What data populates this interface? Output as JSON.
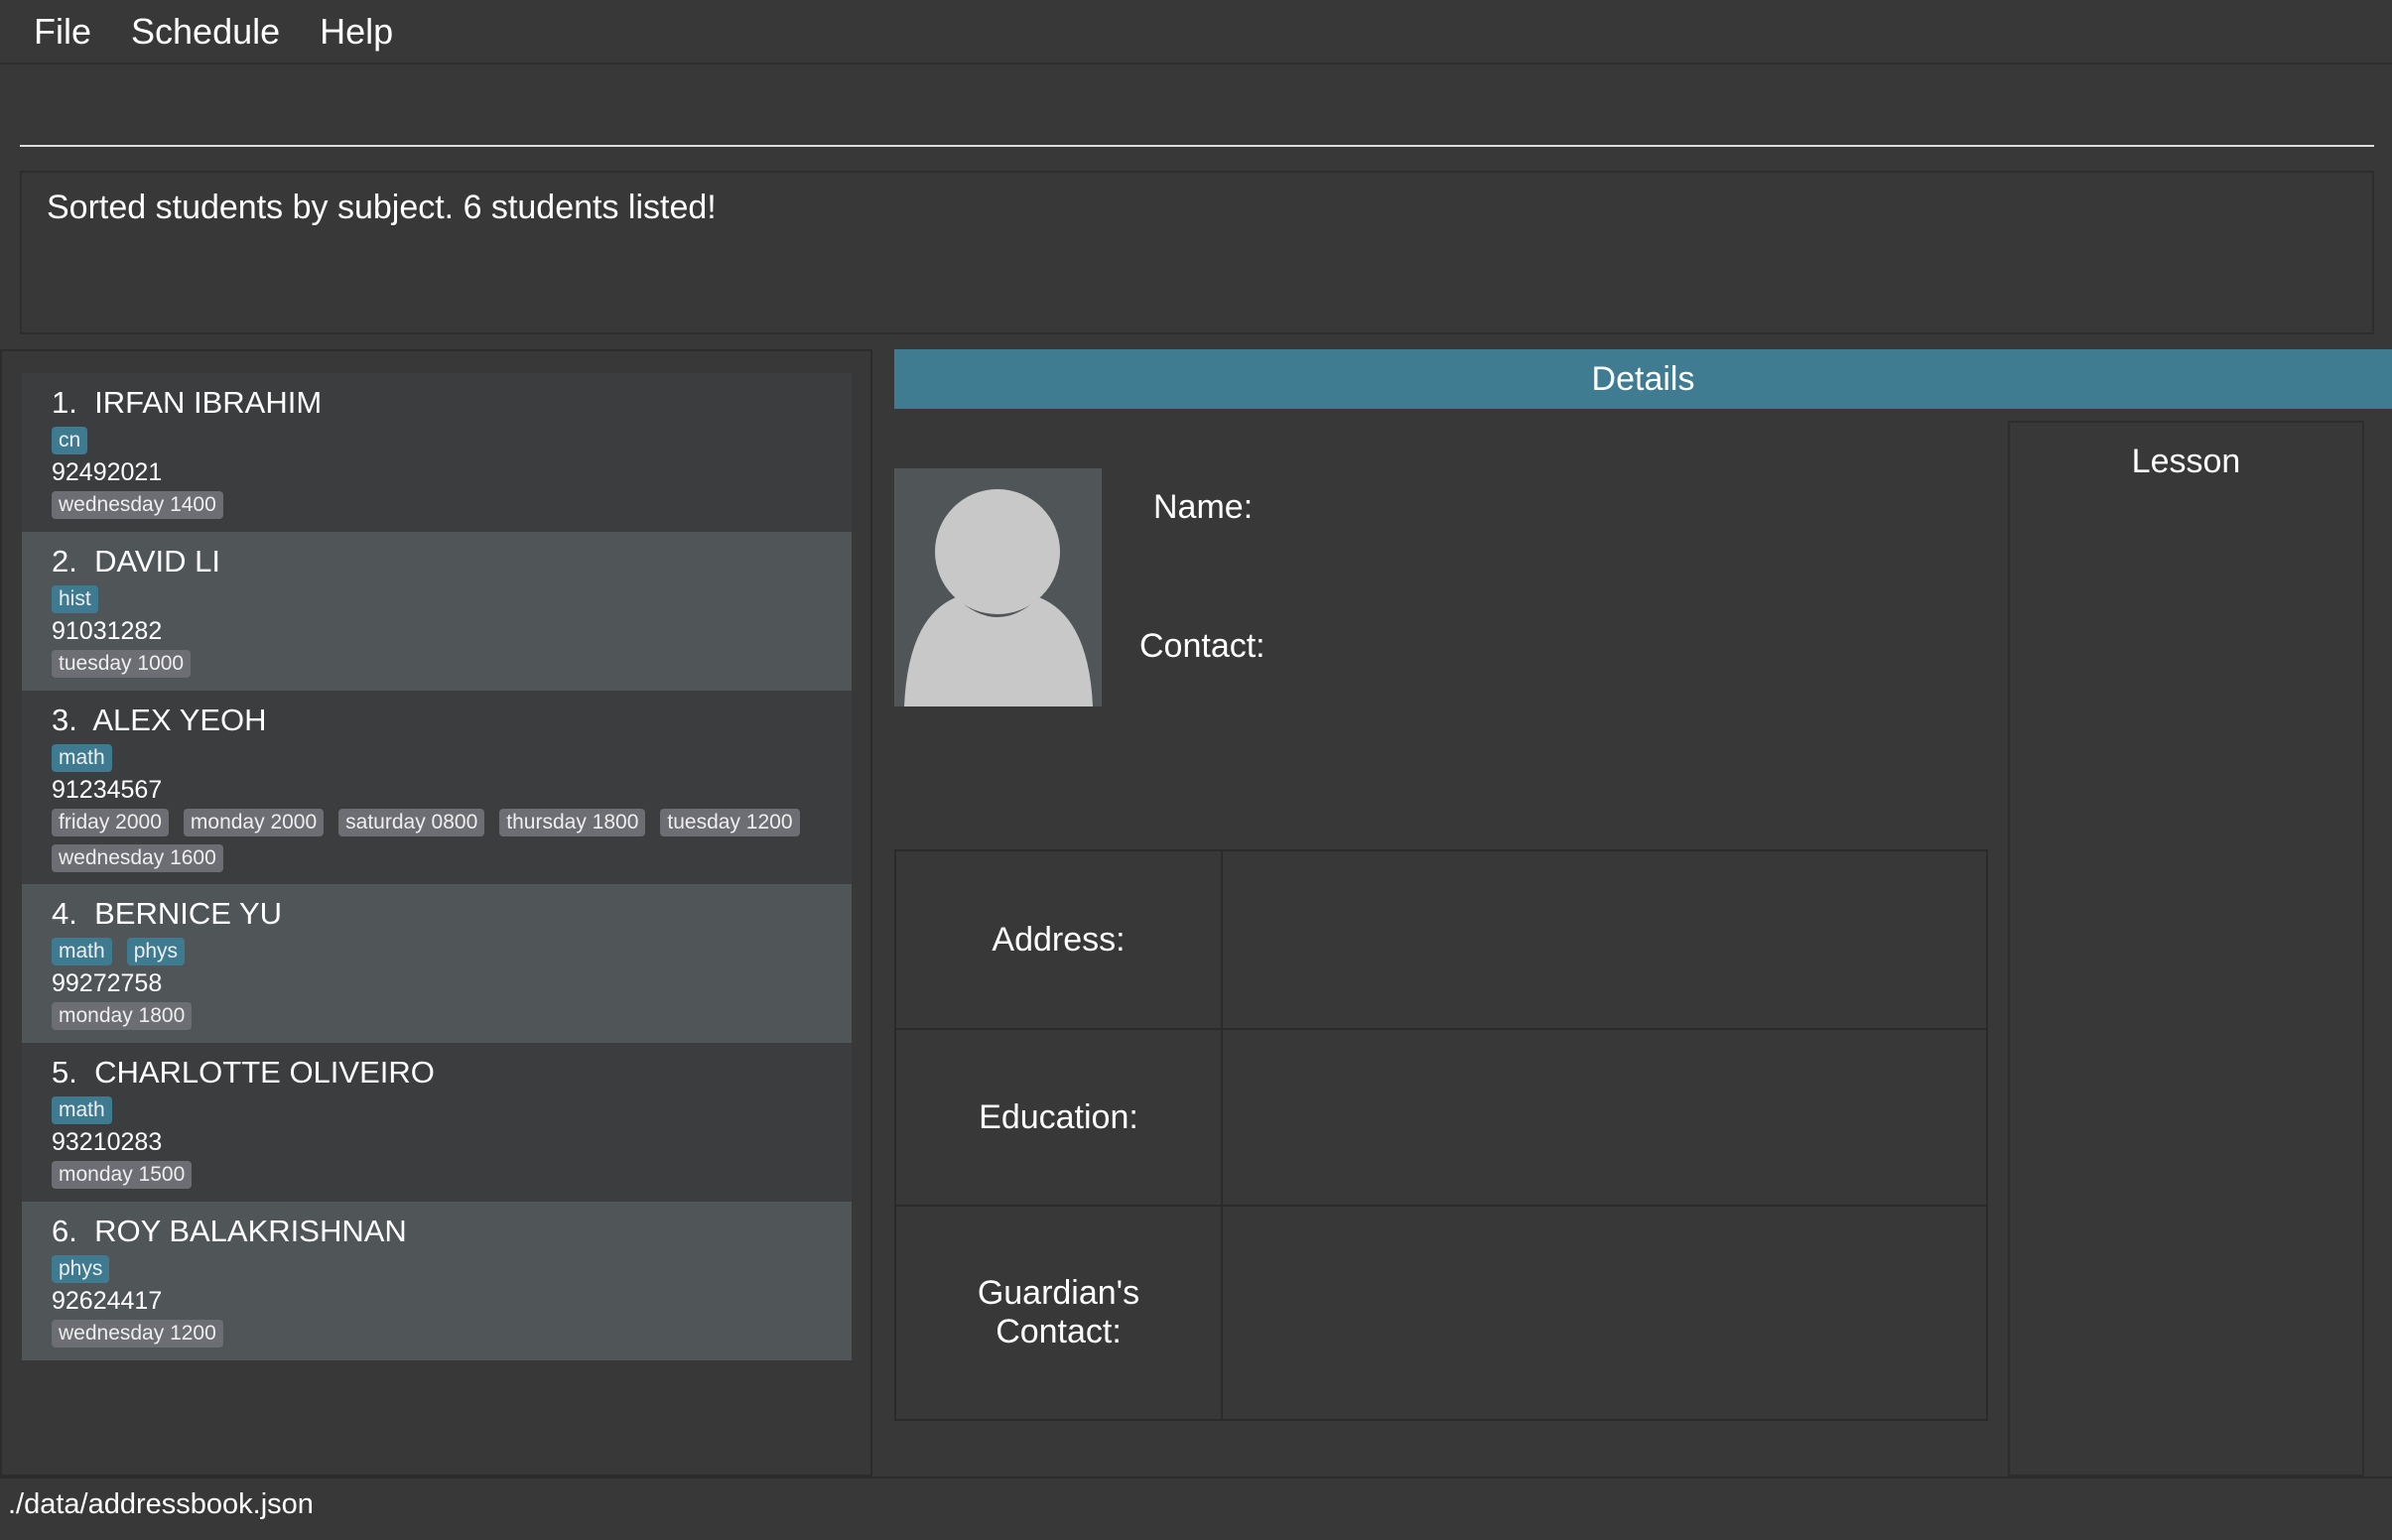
{
  "menu": [
    "File",
    "Schedule",
    "Help"
  ],
  "command": {
    "value": ""
  },
  "result": "Sorted students by subject. 6 students listed!",
  "students": [
    {
      "index": "1.",
      "name": "IRFAN IBRAHIM",
      "subjects": [
        "cn"
      ],
      "phone": "92492021",
      "lessons": [
        "wednesday 1400"
      ]
    },
    {
      "index": "2.",
      "name": "DAVID LI",
      "subjects": [
        "hist"
      ],
      "phone": "91031282",
      "lessons": [
        "tuesday 1000"
      ]
    },
    {
      "index": "3.",
      "name": "ALEX YEOH",
      "subjects": [
        "math"
      ],
      "phone": "91234567",
      "lessons": [
        "friday 2000",
        "monday 2000",
        "saturday 0800",
        "thursday 1800",
        "tuesday 1200",
        "wednesday 1600"
      ]
    },
    {
      "index": "4.",
      "name": "BERNICE YU",
      "subjects": [
        "math",
        "phys"
      ],
      "phone": "99272758",
      "lessons": [
        "monday 1800"
      ]
    },
    {
      "index": "5.",
      "name": "CHARLOTTE OLIVEIRO",
      "subjects": [
        "math"
      ],
      "phone": "93210283",
      "lessons": [
        "monday 1500"
      ]
    },
    {
      "index": "6.",
      "name": "ROY BALAKRISHNAN",
      "subjects": [
        "phys"
      ],
      "phone": "92624417",
      "lessons": [
        "wednesday 1200"
      ]
    }
  ],
  "details": {
    "title": "Details",
    "name_label": "Name:",
    "contact_label": "Contact:",
    "lesson_title": "Lesson",
    "rows": [
      {
        "label": "Address:"
      },
      {
        "label": "Education:"
      },
      {
        "label": "Guardian's Contact:"
      }
    ]
  },
  "status": "./data/addressbook.json",
  "colors": {
    "accent": "#3f7b91",
    "subject_tag": "#3e7b91",
    "lesson_tag": "#6d6d74",
    "card": "#3c3d3f",
    "card_alt": "#505558"
  },
  "icons": {
    "avatar": "person-silhouette-icon"
  }
}
